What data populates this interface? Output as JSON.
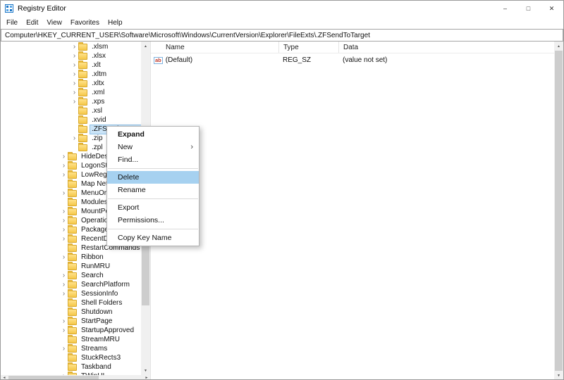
{
  "window": {
    "title": "Registry Editor"
  },
  "menu_bar": {
    "items": [
      "File",
      "Edit",
      "View",
      "Favorites",
      "Help"
    ]
  },
  "address_bar": {
    "value": "Computer\\HKEY_CURRENT_USER\\Software\\Microsoft\\Windows\\CurrentVersion\\Explorer\\FileExts\\.ZFSendToTarget"
  },
  "colors": {
    "selection": "#cbe4f7",
    "menu_highlight": "#a6d1f0",
    "accent": "#1673c6"
  },
  "icons": {
    "expand_arrow": "›",
    "submenu_arrow": "›",
    "scroll_up": "▲",
    "scroll_down": "▼",
    "scroll_left": "◄",
    "scroll_right": "►",
    "minimize": "–",
    "maximize": "□",
    "close": "✕",
    "string_value": "ab"
  },
  "tree": {
    "items": [
      {
        "label": ".xlsm",
        "level": 1,
        "arrow": true
      },
      {
        "label": ".xlsx",
        "level": 1,
        "arrow": true
      },
      {
        "label": ".xlt",
        "level": 1,
        "arrow": true
      },
      {
        "label": ".xltm",
        "level": 1,
        "arrow": true
      },
      {
        "label": ".xltx",
        "level": 1,
        "arrow": true
      },
      {
        "label": ".xml",
        "level": 1,
        "arrow": true
      },
      {
        "label": ".xps",
        "level": 1,
        "arrow": true
      },
      {
        "label": ".xsl",
        "level": 1,
        "arrow": false
      },
      {
        "label": ".xvid",
        "level": 1,
        "arrow": false
      },
      {
        "label": ".ZFSendToTarget",
        "level": 1,
        "arrow": false,
        "selected": true
      },
      {
        "label": ".zip",
        "level": 1,
        "arrow": true
      },
      {
        "label": ".zpl",
        "level": 1,
        "arrow": false
      },
      {
        "label": "HideDesktopIcons",
        "level": 0,
        "arrow": true
      },
      {
        "label": "LogonStats",
        "level": 0,
        "arrow": true
      },
      {
        "label": "LowRegistry",
        "level": 0,
        "arrow": true
      },
      {
        "label": "Map Network Drive MRU",
        "level": 0,
        "arrow": false
      },
      {
        "label": "MenuOrder",
        "level": 0,
        "arrow": true
      },
      {
        "label": "Modules",
        "level": 0,
        "arrow": false
      },
      {
        "label": "MountPoints2",
        "level": 0,
        "arrow": true
      },
      {
        "label": "OperationStatusManager",
        "level": 0,
        "arrow": true
      },
      {
        "label": "Package Installation",
        "level": 0,
        "arrow": true
      },
      {
        "label": "RecentDocs",
        "level": 0,
        "arrow": true
      },
      {
        "label": "RestartCommands",
        "level": 0,
        "arrow": false
      },
      {
        "label": "Ribbon",
        "level": 0,
        "arrow": true
      },
      {
        "label": "RunMRU",
        "level": 0,
        "arrow": false
      },
      {
        "label": "Search",
        "level": 0,
        "arrow": true
      },
      {
        "label": "SearchPlatform",
        "level": 0,
        "arrow": true
      },
      {
        "label": "SessionInfo",
        "level": 0,
        "arrow": true
      },
      {
        "label": "Shell Folders",
        "level": 0,
        "arrow": false
      },
      {
        "label": "Shutdown",
        "level": 0,
        "arrow": false
      },
      {
        "label": "StartPage",
        "level": 0,
        "arrow": true
      },
      {
        "label": "StartupApproved",
        "level": 0,
        "arrow": true
      },
      {
        "label": "StreamMRU",
        "level": 0,
        "arrow": false
      },
      {
        "label": "Streams",
        "level": 0,
        "arrow": true
      },
      {
        "label": "StuckRects3",
        "level": 0,
        "arrow": false
      },
      {
        "label": "Taskband",
        "level": 0,
        "arrow": false
      },
      {
        "label": "TWinUI",
        "level": 0,
        "arrow": true
      }
    ]
  },
  "list": {
    "columns": [
      "Name",
      "Type",
      "Data"
    ],
    "rows": [
      {
        "icon": "ab",
        "name": "(Default)",
        "type": "REG_SZ",
        "data": "(value not set)"
      }
    ]
  },
  "context_menu": {
    "items": [
      {
        "label": "Expand",
        "bold": true
      },
      {
        "label": "New",
        "submenu": true
      },
      {
        "label": "Find..."
      },
      {
        "separator": true
      },
      {
        "label": "Delete",
        "highlighted": true
      },
      {
        "label": "Rename"
      },
      {
        "separator": true
      },
      {
        "label": "Export"
      },
      {
        "label": "Permissions..."
      },
      {
        "separator": true
      },
      {
        "label": "Copy Key Name"
      }
    ]
  }
}
